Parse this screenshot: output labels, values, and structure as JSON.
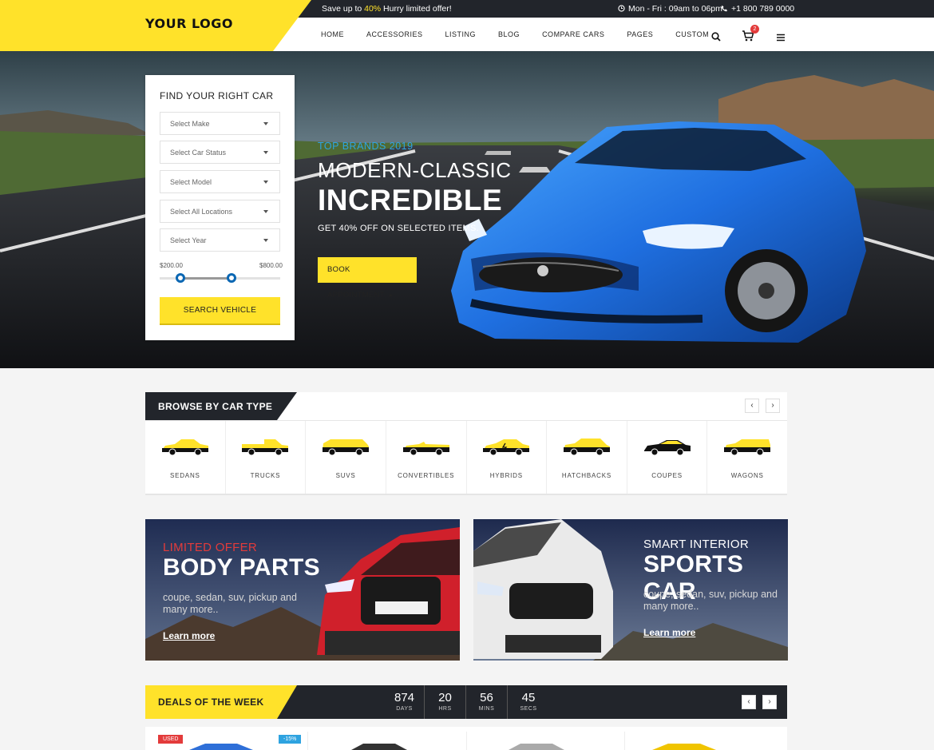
{
  "header": {
    "logo": "YOUR LOGO",
    "promo_prefix": "Save up to ",
    "promo_highlight": "40%",
    "promo_suffix": " Hurry limited offer!",
    "hours": "Mon - Fri : 09am to 06pm",
    "phone": "+1 800 789 0000",
    "nav": [
      "HOME",
      "ACCESSORIES",
      "LISTING",
      "BLOG",
      "COMPARE CARS",
      "PAGES",
      "CUSTOM"
    ],
    "cart_count": "2"
  },
  "search_form": {
    "title": "FIND YOUR RIGHT CAR",
    "selects": [
      "Select Make",
      "Select Car Status",
      "Select Model",
      "Select All Locations",
      "Select Year"
    ],
    "price_min": "$200.00",
    "price_max": "$800.00",
    "button": "SEARCH VEHICLE"
  },
  "hero": {
    "subtitle": "TOP BRANDS 2019",
    "title_line1": "MODERN-CLASSIC",
    "title_line2": "INCREDIBLE",
    "offer": "GET 40% OFF ON SELECTED ITEMS.",
    "button": "BOOK APPOINTMENT",
    "car_color": "#1f6fe0"
  },
  "browse": {
    "title": "BROWSE BY CAR TYPE",
    "types": [
      "SEDANS",
      "TRUCKS",
      "SUVS",
      "CONVERTIBLES",
      "HYBRIDS",
      "HATCHBACKS",
      "COUPES",
      "WAGONS"
    ]
  },
  "promos": [
    {
      "subtitle": "LIMITED OFFER",
      "title": "BODY PARTS",
      "text": "coupe, sedan, suv, pickup and many more..",
      "link": "Learn more"
    },
    {
      "subtitle": "SMART INTERIOR",
      "title": "SPORTS CAR",
      "text": "coupe, sedan, suv, pickup and many more..",
      "link": "Learn more"
    }
  ],
  "deals": {
    "title": "DEALS OF THE WEEK",
    "countdown": [
      {
        "value": "874",
        "unit": "DAYS"
      },
      {
        "value": "20",
        "unit": "HRS"
      },
      {
        "value": "56",
        "unit": "MINS"
      },
      {
        "value": "45",
        "unit": "SECS"
      }
    ],
    "badges": {
      "used": "USED",
      "discount": "-15%"
    }
  },
  "colors": {
    "accent": "#ffe22a",
    "dark": "#22252b",
    "blue": "#2ea3e0",
    "red": "#e33b3b"
  }
}
